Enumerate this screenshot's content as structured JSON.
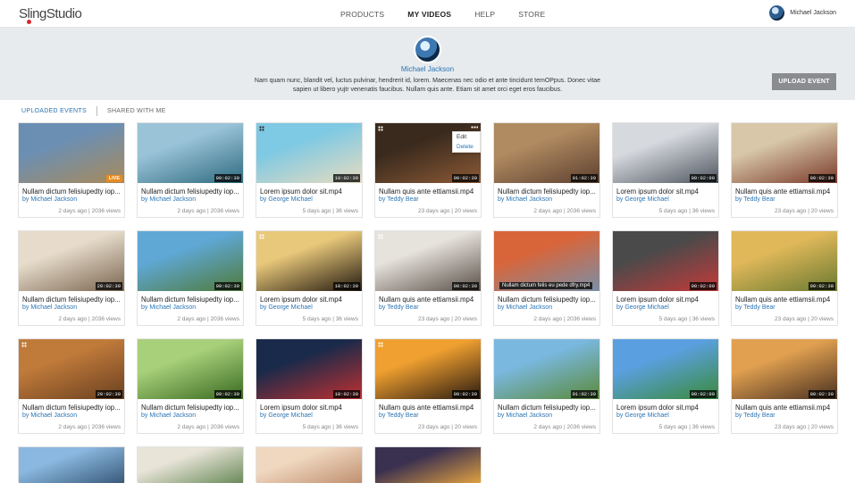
{
  "brand": {
    "logo": "SlingStudio"
  },
  "nav": [
    "PRODUCTS",
    "MY VIDEOS",
    "HELP",
    "STORE"
  ],
  "user": {
    "name": "Michael Jackson"
  },
  "profile": {
    "name": "Michael Jackson",
    "bio": "Nam quam nunc, blandit vel, luctus pulvinar, hendrerit id, lorem. Maecenas nec odio et ante tincidunt temOPpus. Donec vitae sapien ut libero yujtr venenatis faucibus. Nullam quis ante. Etiam sit amet orci eget eros faucibus.",
    "upload_label": "UPLOAD EVENT"
  },
  "tabs": [
    "UPLOADED EVENTS",
    "SHARED WITH ME"
  ],
  "menu": {
    "edit": "Edit",
    "delete": "Delete"
  },
  "tooltip": "Nullam dictum felis eu pede dfry.mp4",
  "cards": [
    {
      "title": "Nullam dictum felisiupedty iop...",
      "by": "by Michael Jackson",
      "meta": "2 days ago  |  2036 views",
      "badge": "LIVE",
      "bg": "#6b8fb3,#a88a5b"
    },
    {
      "title": "Nullam dictum felisiupedty iop...",
      "by": "by Michael Jackson",
      "meta": "2 days ago  |  2036 views",
      "badge": "00:02:30",
      "bg": "#9ac3d8,#2f6b80"
    },
    {
      "title": "Lorem ipsum dolor sit.mp4",
      "by": "by George Michael",
      "meta": "5 days ago  |  36 views",
      "badge": "10:02:30",
      "bg": "#7ec9e3,#e8dcc0"
    },
    {
      "title": "Nullam quis ante ettiamsii.mp4",
      "by": "by Teddy Bear",
      "meta": "23 days ago  |  20 views",
      "badge": "00:02:30",
      "bg": "#3a2a1d,#8c5a36"
    },
    {
      "title": "Nullam dictum felisiupedty iop...",
      "by": "by Michael Jackson",
      "meta": "2 days ago  |  2036 views",
      "badge": "01:02:30",
      "bg": "#b08a60,#5d4030"
    },
    {
      "title": "Lorem ipsum dolor sit.mp4",
      "by": "by George Michael",
      "meta": "5 days ago  |  36 views",
      "badge": "00:02:00",
      "bg": "#d6d9de,#4f5660"
    },
    {
      "title": "Nullam quis ante ettiamsii.mp4",
      "by": "by Teddy Bear",
      "meta": "23 days ago  |  20 views",
      "badge": "00:02:30",
      "bg": "#d8c7a8,#7a3a2a"
    },
    {
      "title": "Nullam dictum felisiupedty iop...",
      "by": "by Michael Jackson",
      "meta": "2 days ago  |  2036 views",
      "badge": "20:02:30",
      "bg": "#e7dccb,#7a6650"
    },
    {
      "title": "Nullam dictum felisiupedty iop...",
      "by": "by Michael Jackson",
      "meta": "2 days ago  |  2036 views",
      "badge": "00:02:30",
      "bg": "#5fa8d6,#4f7a3a"
    },
    {
      "title": "Lorem ipsum dolor sit.mp4",
      "by": "by George Michael",
      "meta": "5 days ago  |  36 views",
      "badge": "10:02:30",
      "bg": "#e8c87a,#241a10"
    },
    {
      "title": "Nullam quis ante ettiamsii.mp4",
      "by": "by Teddy Bear",
      "meta": "23 days ago  |  20 views",
      "badge": "00:02:30",
      "bg": "#e6e2dc,#5a5048"
    },
    {
      "title": "Nullam dictum felisiupedty iop...",
      "by": "by Michael Jackson",
      "meta": "2 days ago  |  2036 views",
      "badge": "",
      "bg": "#d8653a,#7a8fa8"
    },
    {
      "title": "Lorem ipsum dolor sit.mp4",
      "by": "by George Michael",
      "meta": "5 days ago  |  36 views",
      "badge": "00:02:00",
      "bg": "#4a4a4a,#c43a3a"
    },
    {
      "title": "Nullam quis ante ettiamsii.mp4",
      "by": "by Teddy Bear",
      "meta": "23 days ago  |  20 views",
      "badge": "00:02:30",
      "bg": "#e0b85a,#6a7a30"
    },
    {
      "title": "Nullam dictum felisiupedty iop...",
      "by": "by Michael Jackson",
      "meta": "2 days ago  |  2036 views",
      "badge": "20:02:30",
      "bg": "#c07a3a,#6a4020"
    },
    {
      "title": "Nullam dictum felisiupedty iop...",
      "by": "by Michael Jackson",
      "meta": "2 days ago  |  2036 views",
      "badge": "00:02:30",
      "bg": "#a8d07a,#3a6a20"
    },
    {
      "title": "Lorem ipsum dolor sit.mp4",
      "by": "by George Michael",
      "meta": "5 days ago  |  36 views",
      "badge": "10:02:30",
      "bg": "#1a2a4a,#c03030"
    },
    {
      "title": "Nullam quis ante ettiamsii.mp4",
      "by": "by Teddy Bear",
      "meta": "23 days ago  |  20 views",
      "badge": "00:02:30",
      "bg": "#f0a030,#2a1a10"
    },
    {
      "title": "Nullam dictum felisiupedty iop...",
      "by": "by Michael Jackson",
      "meta": "2 days ago  |  2036 views",
      "badge": "01:02:30",
      "bg": "#7ab8e0,#5a8a3a"
    },
    {
      "title": "Lorem ipsum dolor sit.mp4",
      "by": "by George Michael",
      "meta": "5 days ago  |  36 views",
      "badge": "00:02:00",
      "bg": "#5aa0e0,#3a8a3a"
    },
    {
      "title": "Nullam quis ante ettiamsii.mp4",
      "by": "by Teddy Bear",
      "meta": "23 days ago  |  20 views",
      "badge": "00:02:30",
      "bg": "#e0a050,#4a3020"
    },
    {
      "title": "",
      "by": "",
      "meta": "",
      "badge": "",
      "bg": "#8ab8e0,#3a5a7a"
    },
    {
      "title": "",
      "by": "",
      "meta": "",
      "badge": "",
      "bg": "#e8e4d8,#6a8a5a"
    },
    {
      "title": "",
      "by": "",
      "meta": "",
      "badge": "",
      "bg": "#f0d8c0,#c09070"
    },
    {
      "title": "",
      "by": "",
      "meta": "",
      "badge": "",
      "bg": "#3a3050,#e0a040"
    }
  ]
}
